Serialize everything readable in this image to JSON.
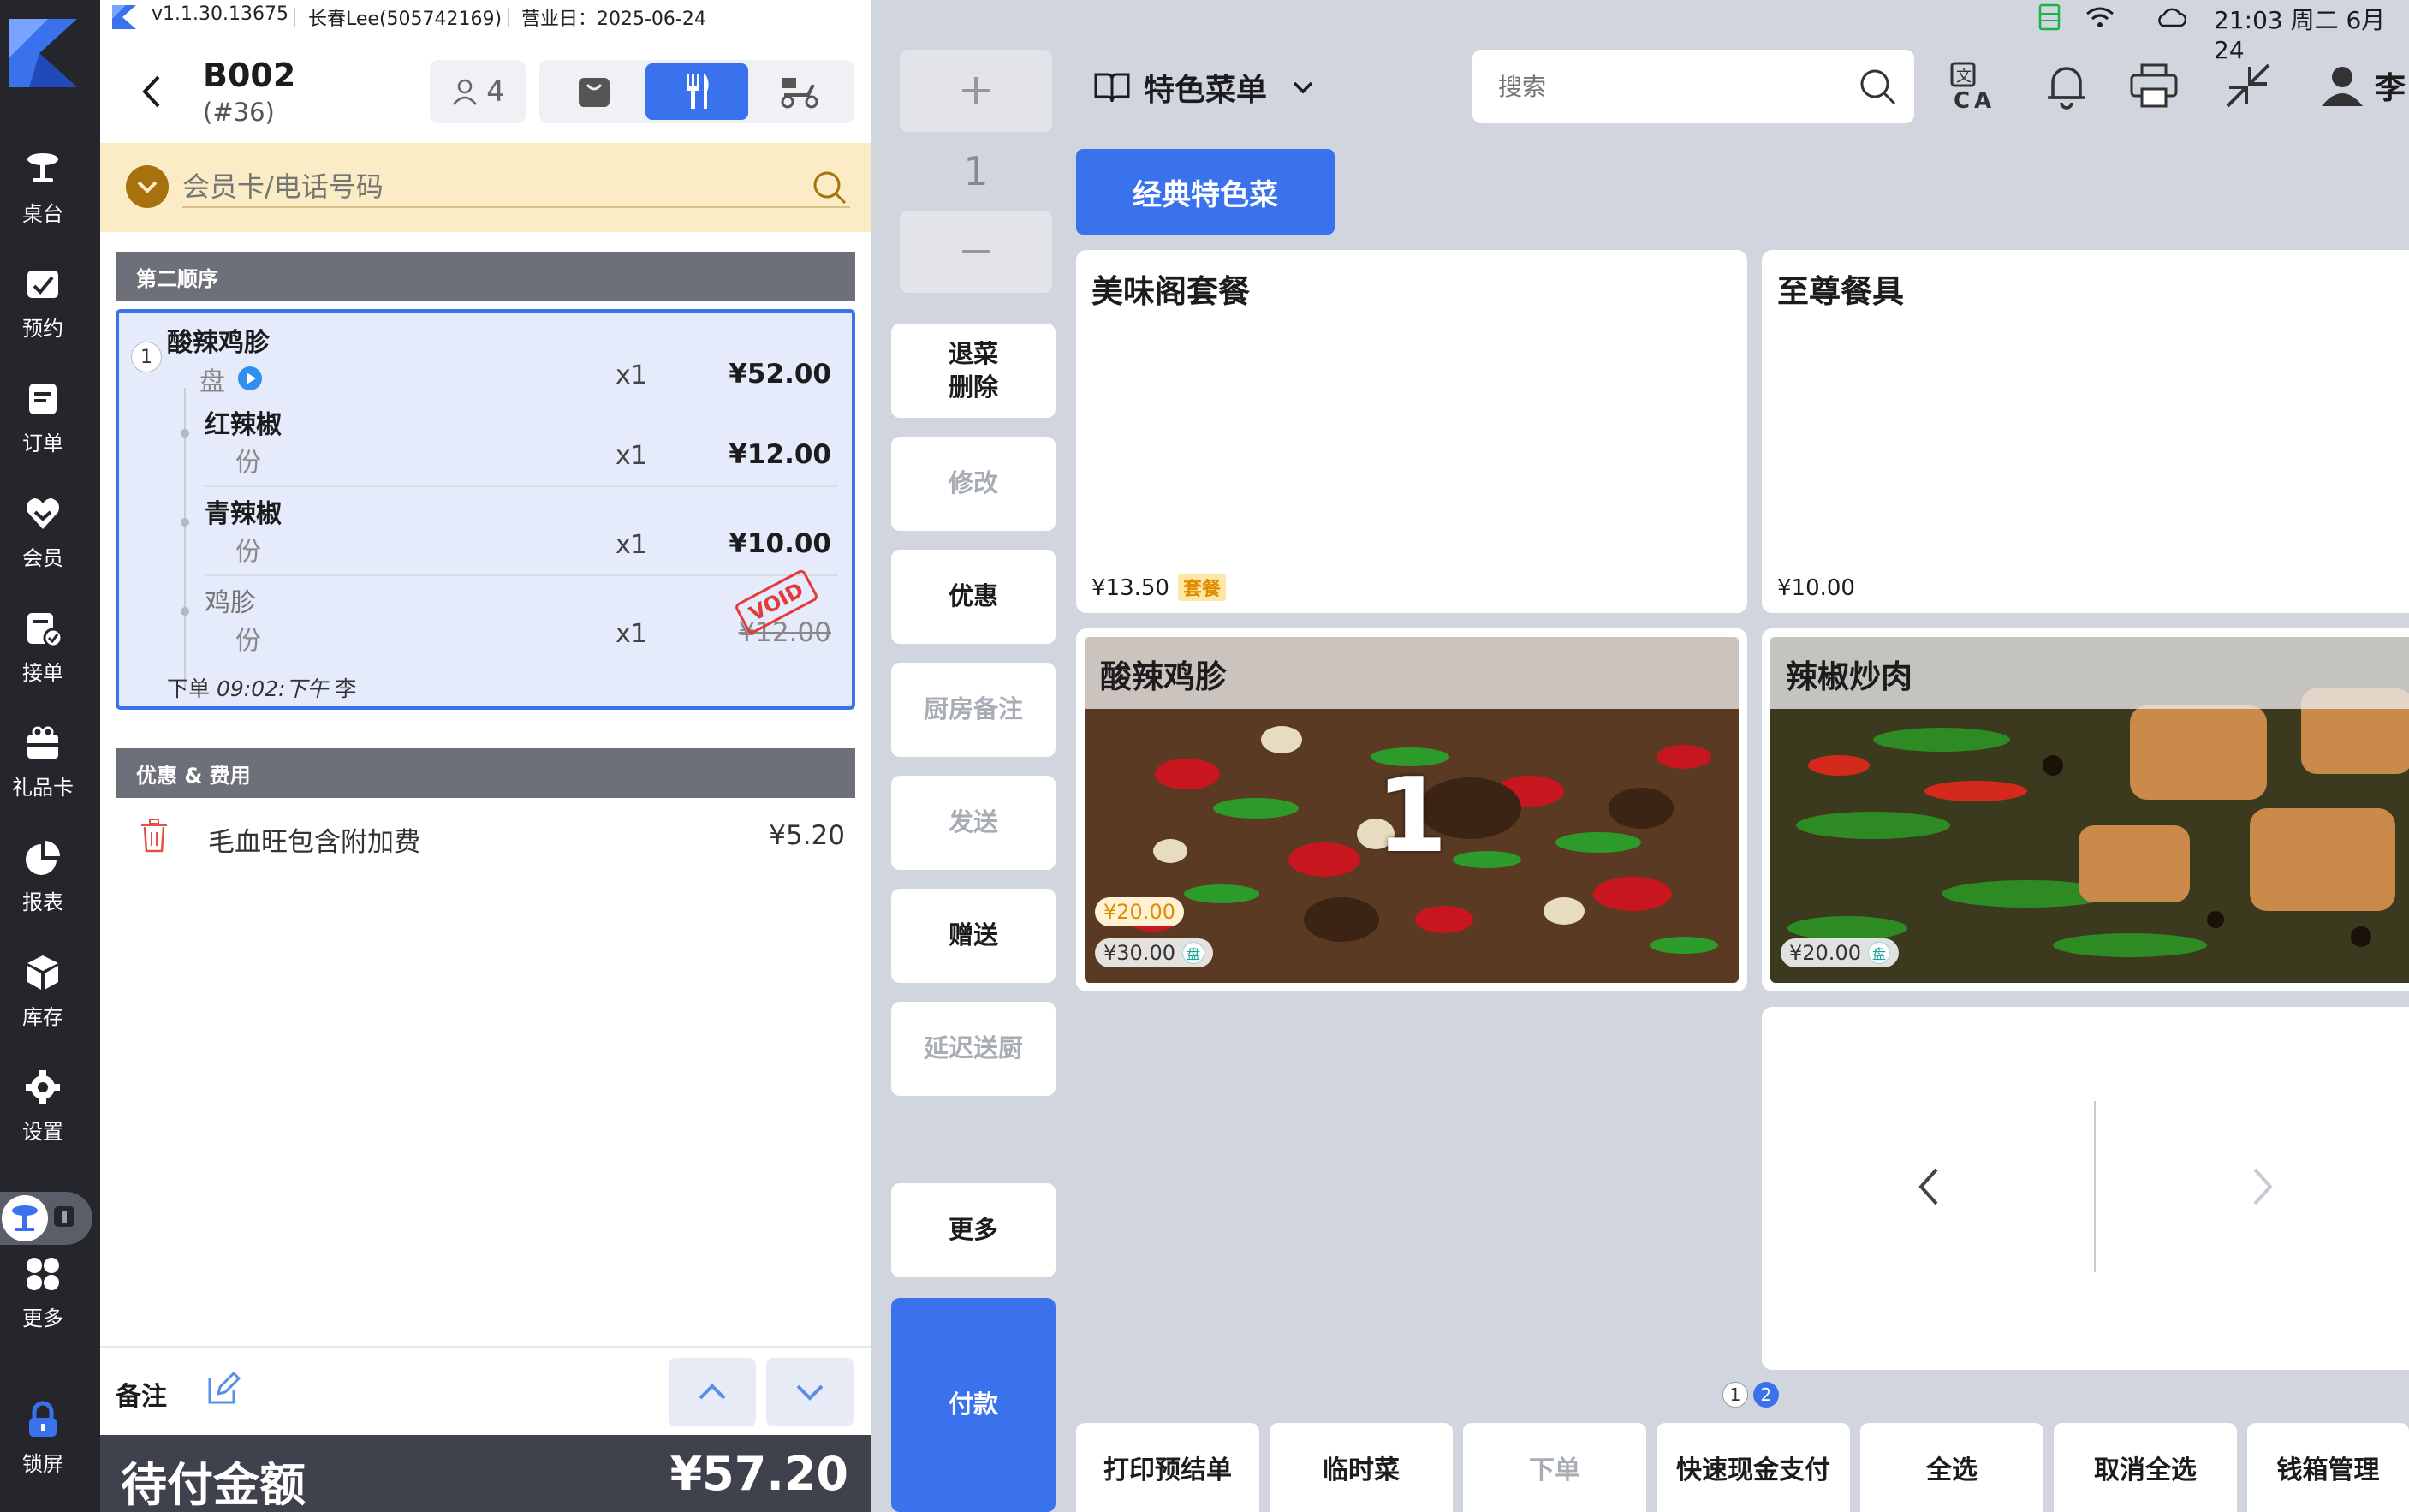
{
  "topbar": {
    "version": "v1.1.30.13675",
    "user": "长春Lee(505742169)",
    "business_day": "营业日：2025-06-24"
  },
  "status_bar": {
    "time": "21:03 周二 6月 24"
  },
  "nav": {
    "items": [
      {
        "label": "桌台",
        "icon": "table-icon"
      },
      {
        "label": "预约",
        "icon": "reservation-icon"
      },
      {
        "label": "订单",
        "icon": "order-icon"
      },
      {
        "label": "会员",
        "icon": "member-icon"
      },
      {
        "label": "接单",
        "icon": "accept-order-icon"
      },
      {
        "label": "礼品卡",
        "icon": "gift-card-icon"
      },
      {
        "label": "报表",
        "icon": "report-icon"
      },
      {
        "label": "库存",
        "icon": "inventory-icon"
      },
      {
        "label": "设置",
        "icon": "settings-icon"
      },
      {
        "label": "更多",
        "icon": "more-icon"
      },
      {
        "label": "锁屏",
        "icon": "lock-icon"
      }
    ]
  },
  "order": {
    "table": "B002",
    "order_no": "(#36)",
    "guests": "4",
    "member_placeholder": "会员卡/电话号码",
    "course_header": "第二顺序",
    "item": {
      "seq": "1",
      "name": "酸辣鸡胗",
      "unit": "盘",
      "qty": "x1",
      "price": "¥52.00",
      "modifiers": [
        {
          "name": "红辣椒",
          "unit": "份",
          "qty": "x1",
          "price": "¥12.00",
          "void": false
        },
        {
          "name": "青辣椒",
          "unit": "份",
          "qty": "x1",
          "price": "¥10.00",
          "void": false
        },
        {
          "name": "鸡胗",
          "unit": "份",
          "qty": "x1",
          "price": "¥12.00",
          "void": true
        }
      ],
      "void_stamp": "VOID",
      "footer_label": "下单",
      "footer_time": "09:02:下午",
      "footer_staff": "李"
    },
    "fees_header": "优惠 & 费用",
    "fee": {
      "label": "毛血旺包含附加费",
      "amount": "¥5.20"
    },
    "remark_label": "备注",
    "due_label": "待付金额",
    "due_amount": "¥57.20"
  },
  "actions": {
    "stepper_value": "1",
    "buttons": [
      {
        "label": "退菜\n删除",
        "enabled": true
      },
      {
        "label": "修改",
        "enabled": false
      },
      {
        "label": "优惠",
        "enabled": true
      },
      {
        "label": "厨房备注",
        "enabled": false
      },
      {
        "label": "发送",
        "enabled": false
      },
      {
        "label": "赠送",
        "enabled": true
      },
      {
        "label": "延迟送厨",
        "enabled": false
      },
      {
        "label": "更多",
        "enabled": true
      }
    ],
    "pay": "付款"
  },
  "menu": {
    "title": "特色菜单",
    "search_placeholder": "搜索",
    "user_initial": "李",
    "category": "经典特色菜",
    "cards": [
      {
        "name": "美味阁套餐",
        "price": "¥13.50",
        "tag": "套餐"
      },
      {
        "name": "至尊餐具",
        "price": "¥10.00"
      },
      {
        "name": "酸辣鸡胗",
        "price": "¥30.00",
        "discount_price": "¥20.00",
        "unit_tag": "盘",
        "count": "1"
      },
      {
        "name": "辣椒炒肉",
        "price": "¥20.00",
        "unit_tag": "盘"
      }
    ],
    "pages": [
      "1",
      "2"
    ],
    "current_page": "2"
  },
  "bottom_buttons": [
    {
      "label": "打印预结单",
      "enabled": true
    },
    {
      "label": "临时菜",
      "enabled": true
    },
    {
      "label": "下单",
      "enabled": false
    },
    {
      "label": "快速现金支付",
      "enabled": true
    },
    {
      "label": "全选",
      "enabled": true
    },
    {
      "label": "取消全选",
      "enabled": true
    },
    {
      "label": "钱箱管理",
      "enabled": true
    }
  ],
  "colors": {
    "accent": "#3a72ed",
    "nav_bg": "#24262b",
    "member_bg": "#fcecc6",
    "due_bg": "#3f424c"
  }
}
